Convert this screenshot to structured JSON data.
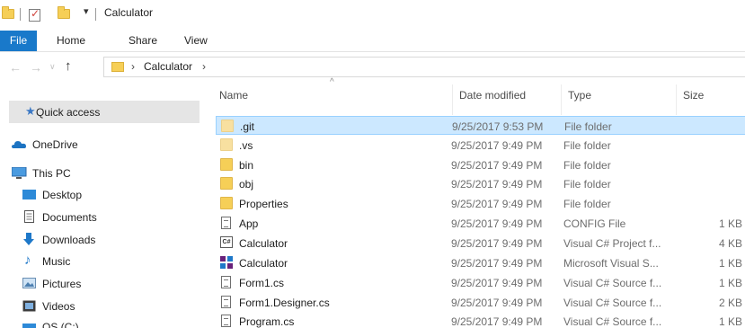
{
  "window": {
    "title": "Calculator",
    "quick_access_toolbar": [
      "properties-icon",
      "new-folder-icon",
      "customize-dropdown"
    ]
  },
  "ribbon": {
    "tabs": [
      {
        "label": "File",
        "active": true
      },
      {
        "label": "Home"
      },
      {
        "label": "Share"
      },
      {
        "label": "View"
      }
    ]
  },
  "nav": {
    "back": "←",
    "forward": "→",
    "recent": "∨",
    "up": "↑"
  },
  "address": {
    "crumbs": [
      "Calculator"
    ],
    "chevron": "›"
  },
  "sidebar": {
    "items": [
      {
        "label": "Quick access",
        "icon": "star-icon",
        "selected": true
      },
      {
        "label": "OneDrive",
        "icon": "cloud-icon"
      },
      {
        "label": "This PC",
        "icon": "computer-icon"
      },
      {
        "label": "Desktop",
        "icon": "desktop-icon"
      },
      {
        "label": "Documents",
        "icon": "documents-icon"
      },
      {
        "label": "Downloads",
        "icon": "download-icon"
      },
      {
        "label": "Music",
        "icon": "music-icon"
      },
      {
        "label": "Pictures",
        "icon": "pictures-icon"
      },
      {
        "label": "Videos",
        "icon": "videos-icon"
      },
      {
        "label": "OS (C:)",
        "icon": "drive-icon"
      }
    ]
  },
  "filelist": {
    "sort_indicator": "^",
    "columns": [
      "Name",
      "Date modified",
      "Type",
      "Size"
    ],
    "rows": [
      {
        "name": ".git",
        "date": "9/25/2017 9:53 PM",
        "type": "File folder",
        "size": "",
        "icon": "folder-icon",
        "selected": true
      },
      {
        "name": ".vs",
        "date": "9/25/2017 9:49 PM",
        "type": "File folder",
        "size": "",
        "icon": "folder-icon"
      },
      {
        "name": "bin",
        "date": "9/25/2017 9:49 PM",
        "type": "File folder",
        "size": "",
        "icon": "folder-icon"
      },
      {
        "name": "obj",
        "date": "9/25/2017 9:49 PM",
        "type": "File folder",
        "size": "",
        "icon": "folder-icon"
      },
      {
        "name": "Properties",
        "date": "9/25/2017 9:49 PM",
        "type": "File folder",
        "size": "",
        "icon": "folder-icon"
      },
      {
        "name": "App",
        "date": "9/25/2017 9:49 PM",
        "type": "CONFIG File",
        "size": "1 KB",
        "icon": "config-file-icon"
      },
      {
        "name": "Calculator",
        "date": "9/25/2017 9:49 PM",
        "type": "Visual C# Project f...",
        "size": "4 KB",
        "icon": "csharp-project-icon"
      },
      {
        "name": "Calculator",
        "date": "9/25/2017 9:49 PM",
        "type": "Microsoft Visual S...",
        "size": "1 KB",
        "icon": "visual-studio-solution-icon"
      },
      {
        "name": "Form1.cs",
        "date": "9/25/2017 9:49 PM",
        "type": "Visual C# Source f...",
        "size": "1 KB",
        "icon": "csharp-source-icon"
      },
      {
        "name": "Form1.Designer.cs",
        "date": "9/25/2017 9:49 PM",
        "type": "Visual C# Source f...",
        "size": "2 KB",
        "icon": "csharp-source-icon"
      },
      {
        "name": "Program.cs",
        "date": "9/25/2017 9:49 PM",
        "type": "Visual C# Source f...",
        "size": "1 KB",
        "icon": "csharp-source-icon"
      }
    ]
  },
  "colors": {
    "file_tab": "#1979ca",
    "selection": "#cce8ff",
    "selection_border": "#99d1ff",
    "folder": "#f6cf57",
    "quick_access_bg": "#e5e5e5"
  }
}
